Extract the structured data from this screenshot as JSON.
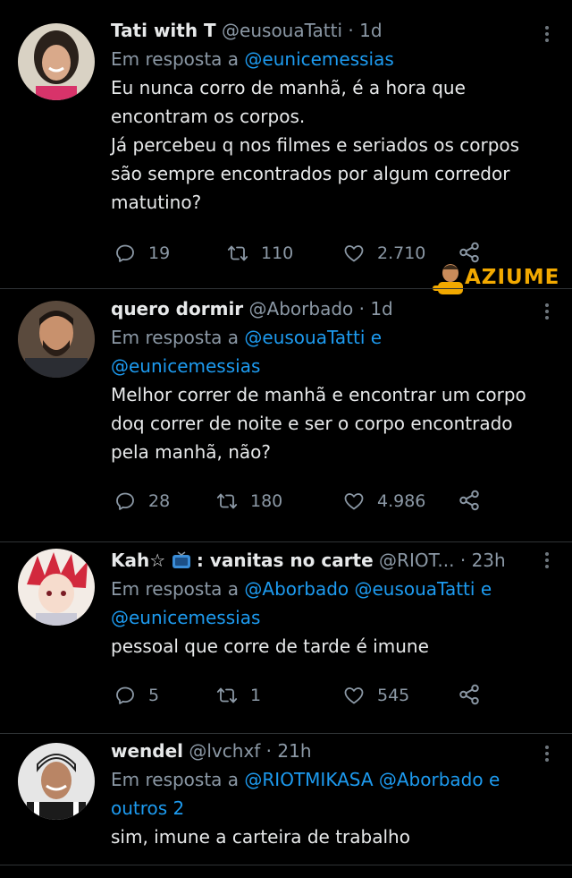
{
  "watermark": {
    "text": "AZIUME",
    "color": "#f2a900"
  },
  "colors": {
    "link": "#1d9bf0",
    "muted": "#8b98a5",
    "text": "#e7e9ea",
    "background": "#000000"
  },
  "tweets": [
    {
      "name": "Tati with T",
      "handle": "@eusouaTatti · 1d",
      "reply_prefix": "Em resposta a",
      "reply_line1_mentions": "@eunicemessias",
      "body": [
        "Eu nunca corro de manhã, é a hora que",
        "encontram os corpos.",
        "Já percebeu q nos filmes e seriados os corpos",
        "são sempre encontrados por algum corredor",
        "matutino?"
      ],
      "replies": "19",
      "retweets": "110",
      "likes": "2.710"
    },
    {
      "name": "quero dormir",
      "handle": "@Aborbado · 1d",
      "reply_prefix": "Em resposta a",
      "reply_line1_mentions": "@eusouaTatti",
      "reply_line1_suffix": "e",
      "reply_line2": "@eunicemessias",
      "body": [
        "Melhor correr de manhã e encontrar um corpo",
        "doq correr de noite e ser o corpo encontrado",
        "pela manhã, não?"
      ],
      "replies": "28",
      "retweets": "180",
      "likes": "4.986"
    },
    {
      "name_part1": "Kah☆",
      "name_part2": ": vanitas no carte",
      "handle": "@RIOT...",
      "time": "· 23h",
      "reply_prefix": "Em resposta a",
      "reply_line1_mentions": "@Aborbado @eusouaTatti",
      "reply_line1_suffix": "e",
      "reply_line2": "@eunicemessias",
      "body": [
        "pessoal que corre de tarde é imune"
      ],
      "replies": "5",
      "retweets": "1",
      "likes": "545"
    },
    {
      "name": "wendel",
      "handle": "@lvchxf · 21h",
      "reply_prefix": "Em resposta a",
      "reply_line1_mentions": "@RIOTMIKASA @Aborbado",
      "reply_line1_suffix": "e",
      "reply_line2": "outros 2",
      "body": [
        "sim, imune a carteira de trabalho"
      ]
    }
  ]
}
